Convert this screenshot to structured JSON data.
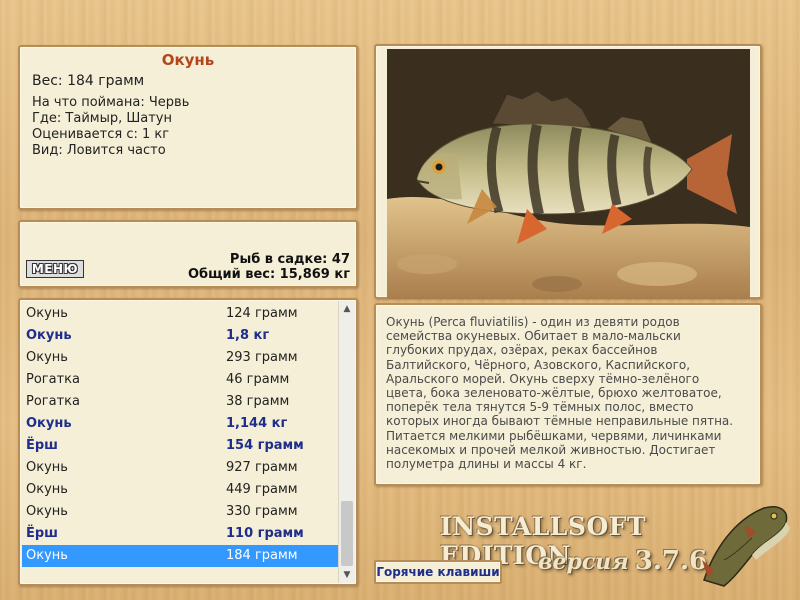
{
  "info": {
    "fish_name": "Окунь",
    "weight_label": "Вес: 184 грамм",
    "bait": "На что поймана: Червь",
    "location": "Где: Таймыр, Шатун",
    "valued_from": "Оценивается с: 1 кг",
    "kind": "Вид: Ловится часто"
  },
  "stats": {
    "menu_label": "МЕНЮ",
    "fish_in_keepnet": "Рыб в садке: 47",
    "total_weight": "Общий вес: 15,869 кг"
  },
  "catch_list": [
    {
      "name": "Окунь",
      "weight": "124 грамм",
      "bold": false,
      "selected": false
    },
    {
      "name": "Окунь",
      "weight": "1,8 кг",
      "bold": true,
      "selected": false
    },
    {
      "name": "Окунь",
      "weight": "293 грамм",
      "bold": false,
      "selected": false
    },
    {
      "name": "Рогатка",
      "weight": "46 грамм",
      "bold": false,
      "selected": false
    },
    {
      "name": "Рогатка",
      "weight": "38 грамм",
      "bold": false,
      "selected": false
    },
    {
      "name": "Окунь",
      "weight": "1,144 кг",
      "bold": true,
      "selected": false
    },
    {
      "name": "Ёрш",
      "weight": "154 грамм",
      "bold": true,
      "selected": false
    },
    {
      "name": "Окунь",
      "weight": "927 грамм",
      "bold": false,
      "selected": false
    },
    {
      "name": "Окунь",
      "weight": "449 грамм",
      "bold": false,
      "selected": false
    },
    {
      "name": "Окунь",
      "weight": "330 грамм",
      "bold": false,
      "selected": false
    },
    {
      "name": "Ёрш",
      "weight": "110 грамм",
      "bold": true,
      "selected": false
    },
    {
      "name": "Окунь",
      "weight": "184 грамм",
      "bold": false,
      "selected": true
    }
  ],
  "description": "Окунь (Perca fluviatilis) - один из девяти родов семейства окуневых. Обитает в мало-мальски глубоких прудах, озёрах, реках бассейнов Балтийского, Чёрного, Азовского, Каспийского, Аральского морей. Окунь сверху тёмно-зелёного цвета, бока зеленовато-жёлтые, брюхо желтоватое, поперёк тела тянутся 5-9 тёмных полос, вместо которых иногда бывают тёмные неправильные пятна. Питается мелкими рыбёшками, червями, личинками насекомых и прочей мелкой живностью. Достигает полуметра длины и массы 4 кг.",
  "brand": {
    "edition": "INSTALLSOFT EDITION",
    "version_word": "версия",
    "version_number": "3.7.6"
  },
  "hotkeys_label": "Горячие клавиши",
  "colors": {
    "accent_title": "#b5451b",
    "bold_row": "#1f2e8c",
    "selection": "#3399ff",
    "panel_bg": "#f4efd6"
  }
}
